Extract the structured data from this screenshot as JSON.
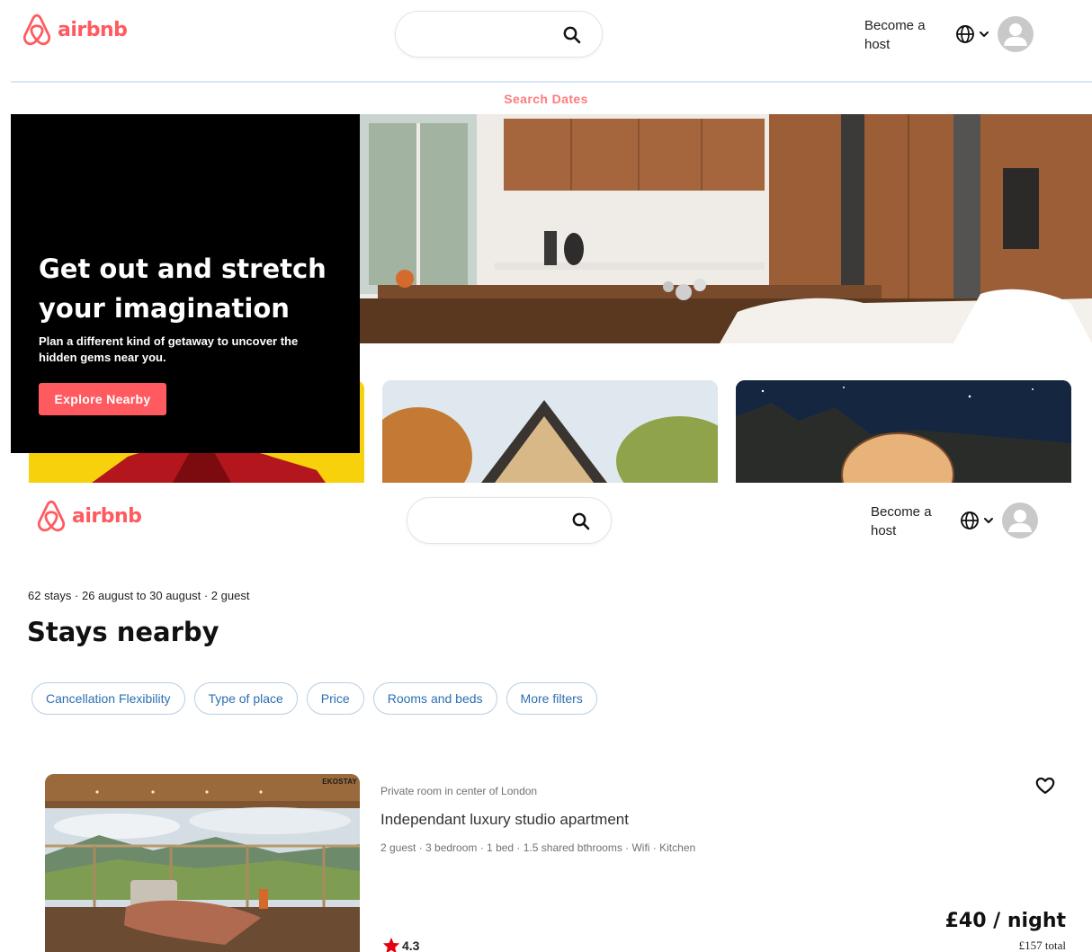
{
  "brand": {
    "name": "airbnb",
    "color": "#ff5a5f"
  },
  "header": {
    "host_label": "Become a host",
    "icons": [
      "airbnb-logo-icon",
      "search-icon",
      "globe-icon",
      "chevron-down-icon",
      "user-avatar-icon"
    ]
  },
  "top": {
    "search_dates_label": "Search Dates",
    "hero": {
      "title": "Get out and stretch your imagination",
      "subtitle": "Plan a different kind of getaway to uncover the hidden gems near you.",
      "cta_label": "Explore Nearby"
    }
  },
  "listings_page": {
    "results_meta": "62 stays · 26 august to 30 august · 2 guest",
    "title": "Stays nearby",
    "filters": [
      "Cancellation Flexibility",
      "Type of place",
      "Price",
      "Rooms and beds",
      "More filters"
    ],
    "listing": {
      "photo_watermark": "EKOSTAY",
      "type": "Private room in center of London",
      "title": "Independant luxury studio apartment",
      "amenities": "2 guest · 3 bedroom · 1 bed · 1.5 shared bthrooms · Wifi · Kitchen",
      "rating": "4.3",
      "price": "£40 / night",
      "total": "£157 total"
    }
  },
  "colors": {
    "accent": "#ff5a5f",
    "filter_text": "#2c6fb2",
    "filter_border": "#b8cfe4",
    "star": "#e3000f"
  }
}
